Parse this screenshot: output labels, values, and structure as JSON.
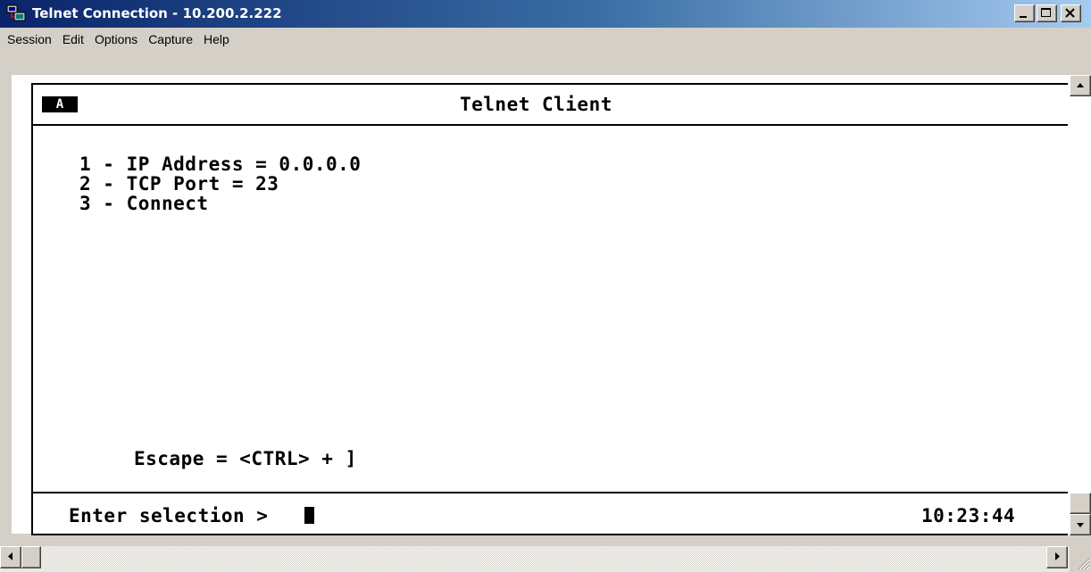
{
  "window": {
    "title": "Telnet Connection - 10.200.2.222",
    "icon": "telnet-app-icon",
    "controls": [
      "minimize-icon",
      "maximize-icon",
      "close-icon"
    ]
  },
  "menu": {
    "items": [
      {
        "label": "Session"
      },
      {
        "label": "Edit"
      },
      {
        "label": "Options"
      },
      {
        "label": "Capture"
      },
      {
        "label": "Help"
      }
    ]
  },
  "terminal": {
    "session_indicator": "A",
    "header_title": "Telnet Client",
    "options": [
      "1 - IP Address = 0.0.0.0",
      "2 - TCP Port = 23",
      "3 - Connect"
    ],
    "escape_hint": "Escape = <CTRL> + ]",
    "prompt": "Enter selection >",
    "clock": "10:23:44"
  }
}
